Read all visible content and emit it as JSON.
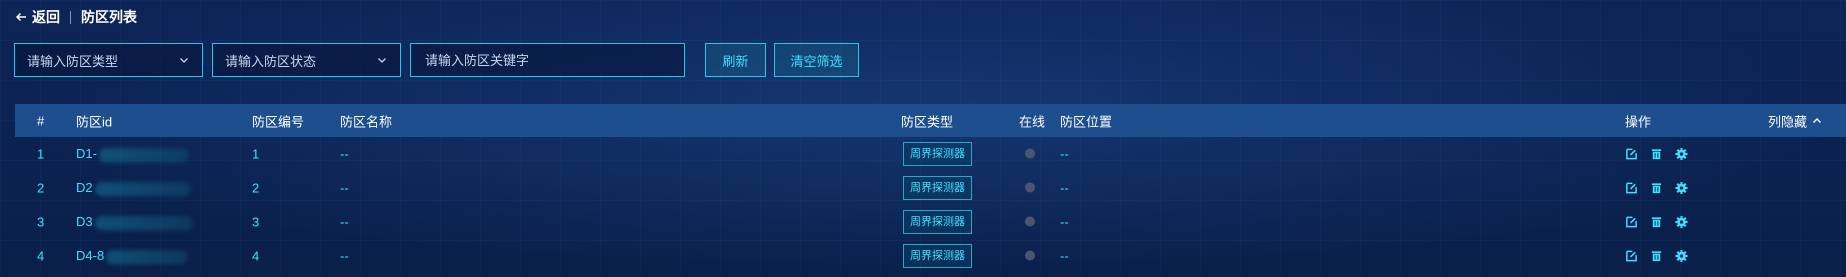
{
  "header": {
    "back_label": "返回",
    "title": "防区列表"
  },
  "filters": {
    "type_select_placeholder": "请输入防区类型",
    "status_select_placeholder": "请输入防区状态",
    "keyword_placeholder": "请输入防区关键字",
    "refresh_label": "刷新",
    "clear_label": "清空筛选"
  },
  "table": {
    "columns": {
      "idx": "#",
      "id": "防区id",
      "code": "防区编号",
      "name": "防区名称",
      "type": "防区类型",
      "online": "在线",
      "location": "防区位置",
      "ops": "操作",
      "col_hide": "列隐藏"
    },
    "rows": [
      {
        "idx": "1",
        "id": "D1-",
        "code": "1",
        "name": "--",
        "type": "周界探测器",
        "location": "--",
        "online": false
      },
      {
        "idx": "2",
        "id": "D2",
        "code": "2",
        "name": "--",
        "type": "周界探测器",
        "location": "--",
        "online": false
      },
      {
        "idx": "3",
        "id": "D3",
        "code": "3",
        "name": "--",
        "type": "周界探测器",
        "location": "--",
        "online": false
      },
      {
        "idx": "4",
        "id": "D4-8",
        "code": "4",
        "name": "--",
        "type": "周界探测器",
        "location": "--",
        "online": false
      }
    ]
  },
  "colors": {
    "background": "#0a1f4e",
    "accent": "#25c6e6",
    "cell_text": "#3fe0ff",
    "header_row": "#1d4f8f",
    "offline_dot": "#4a5670"
  },
  "icons": {
    "back": "arrow-left-icon",
    "select_chevron": "chevron-down-icon",
    "col_hide": "chevron-up-icon",
    "edit": "edit-icon",
    "delete": "trash-icon",
    "settings": "gear-icon"
  }
}
